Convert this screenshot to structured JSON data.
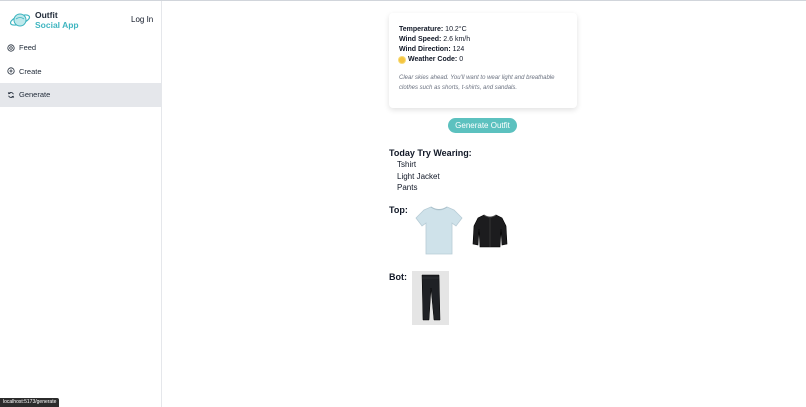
{
  "app": {
    "brand_line1": "Outfit",
    "brand_line2": "Social App",
    "accent_color": "#3fb5c0",
    "login_label": "Log In"
  },
  "sidebar": {
    "items": [
      {
        "label": "Feed",
        "icon": "feed-icon",
        "active": false
      },
      {
        "label": "Create",
        "icon": "plus-circle-icon",
        "active": false
      },
      {
        "label": "Generate",
        "icon": "refresh-icon",
        "active": true
      }
    ]
  },
  "weather": {
    "temperature_label": "Temperature:",
    "temperature_value": "10.2°C",
    "wind_speed_label": "Wind Speed:",
    "wind_speed_value": "2.6 km/h",
    "wind_direction_label": "Wind Direction:",
    "wind_direction_value": "124",
    "weather_code_label": "Weather Code:",
    "weather_code_value": "0",
    "weather_icon": "sun-icon",
    "description": "Clear skies ahead. You'll want to wear light and breathable clothes such as shorts, t-shirts, and sandals."
  },
  "generate_button": {
    "label": "Generate Outfit",
    "color": "#5cc1bf"
  },
  "suggestion": {
    "title": "Today Try Wearing:",
    "items": [
      "Tshirt",
      "Light Jacket",
      "Pants"
    ]
  },
  "top_section": {
    "label": "Top:",
    "images": [
      "tshirt-image",
      "jacket-image"
    ]
  },
  "bottom_section": {
    "label": "Bot:",
    "images": [
      "pants-image"
    ]
  },
  "status_bar": {
    "url": "localhost:5173/generate"
  }
}
